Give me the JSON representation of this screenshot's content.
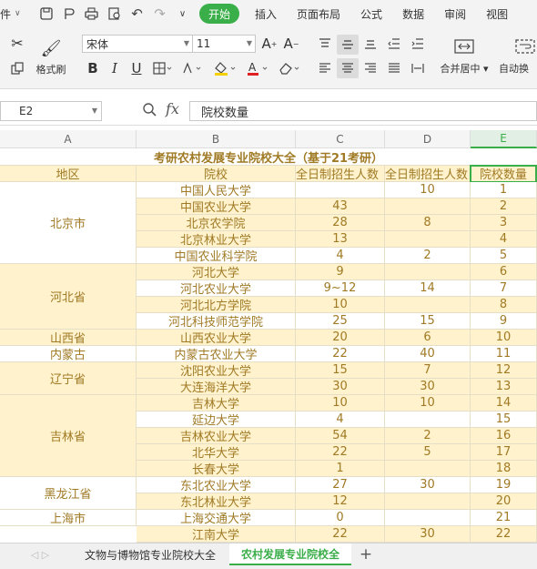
{
  "menubar": {
    "file_label": "文件",
    "start_label": "开始",
    "tabs": [
      "插入",
      "页面布局",
      "公式",
      "数据",
      "审阅",
      "视图"
    ]
  },
  "ribbon": {
    "format_painter_label": "格式刷",
    "font_name": "宋体",
    "font_size": "11",
    "merge_label": "合并居中",
    "autowrap_label": "自动换"
  },
  "formula_bar": {
    "name_box": "E2",
    "fx_label": "fx",
    "content": "院校数量"
  },
  "columns": [
    "A",
    "B",
    "C",
    "D",
    "E"
  ],
  "sheet": {
    "title": "考研农村发展专业院校大全（基于21考研）",
    "headers": [
      "地区",
      "院校",
      "全日制招生人数",
      "全日制招生人数",
      "院校数量"
    ],
    "regions": [
      {
        "name": "北京市"
      },
      {
        "name": "河北省"
      },
      {
        "name": "山西省"
      },
      {
        "name": "内蒙古"
      },
      {
        "name": "辽宁省"
      },
      {
        "name": "吉林省"
      },
      {
        "name": "黑龙江省"
      },
      {
        "name": "上海市"
      }
    ],
    "rows": [
      {
        "school": "中国人民大学",
        "c": "",
        "d": "10",
        "e": "1"
      },
      {
        "school": "中国农业大学",
        "c": "43",
        "d": "",
        "e": "2"
      },
      {
        "school": "北京农学院",
        "c": "28",
        "d": "8",
        "e": "3"
      },
      {
        "school": "北京林业大学",
        "c": "13",
        "d": "",
        "e": "4"
      },
      {
        "school": "中国农业科学院",
        "c": "4",
        "d": "2",
        "e": "5"
      },
      {
        "school": "河北大学",
        "c": "9",
        "d": "",
        "e": "6"
      },
      {
        "school": "河北农业大学",
        "c": "9~12",
        "d": "14",
        "e": "7"
      },
      {
        "school": "河北北方学院",
        "c": "10",
        "d": "",
        "e": "8"
      },
      {
        "school": "河北科技师范学院",
        "c": "25",
        "d": "15",
        "e": "9"
      },
      {
        "school": "山西农业大学",
        "c": "20",
        "d": "6",
        "e": "10"
      },
      {
        "school": "内蒙古农业大学",
        "c": "22",
        "d": "40",
        "e": "11"
      },
      {
        "school": "沈阳农业大学",
        "c": "15",
        "d": "7",
        "e": "12"
      },
      {
        "school": "大连海洋大学",
        "c": "30",
        "d": "30",
        "e": "13"
      },
      {
        "school": "吉林大学",
        "c": "10",
        "d": "10",
        "e": "14"
      },
      {
        "school": "延边大学",
        "c": "4",
        "d": "",
        "e": "15"
      },
      {
        "school": "吉林农业大学",
        "c": "54",
        "d": "2",
        "e": "16"
      },
      {
        "school": "北华大学",
        "c": "22",
        "d": "5",
        "e": "17"
      },
      {
        "school": "长春大学",
        "c": "1",
        "d": "",
        "e": "18"
      },
      {
        "school": "东北农业大学",
        "c": "27",
        "d": "30",
        "e": "19"
      },
      {
        "school": "东北林业大学",
        "c": "12",
        "d": "",
        "e": "20"
      },
      {
        "school": "上海交通大学",
        "c": "0",
        "d": "",
        "e": "21"
      },
      {
        "school": "江南大学",
        "c": "22",
        "d": "30",
        "e": "22"
      }
    ]
  },
  "sheet_tabs": {
    "tab1": "文物与博物馆专业院校大全",
    "tab2": "农村发展专业院校全",
    "add": "+"
  },
  "colors": {
    "accent": "#3aae48",
    "band": "#fff2cc",
    "text": "#a07a24"
  }
}
